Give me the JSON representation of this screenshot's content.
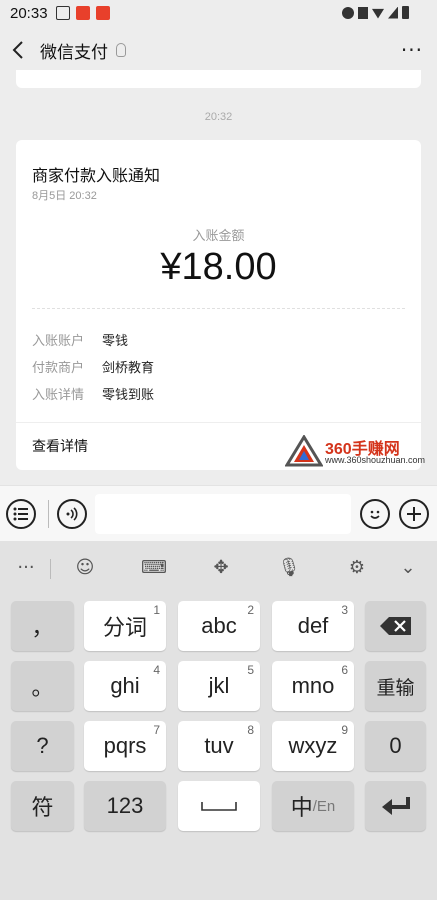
{
  "status_bar": {
    "time": "20:33"
  },
  "header": {
    "title": "微信支付",
    "more": "···"
  },
  "chat": {
    "timestamp": "20:32"
  },
  "card": {
    "title": "商家付款入账通知",
    "date": "8月5日  20:32",
    "amount_label": "入账金额",
    "amount": "¥18.00",
    "rows": [
      {
        "key": "入账账户",
        "value": "零钱"
      },
      {
        "key": "付款商户",
        "value": "剑桥教育"
      },
      {
        "key": "入账详情",
        "value": "零钱到账"
      }
    ],
    "detail_link": "查看详情"
  },
  "watermark": {
    "text": "360手赚网",
    "url": "www.360shouzhuan.com"
  },
  "keyboard": {
    "keys": [
      {
        "label": "，",
        "num": ""
      },
      {
        "label": "分词",
        "num": "1"
      },
      {
        "label": "abc",
        "num": "2"
      },
      {
        "label": "def",
        "num": "3"
      },
      {
        "label": "。",
        "num": ""
      },
      {
        "label": "ghi",
        "num": "4"
      },
      {
        "label": "jkl",
        "num": "5"
      },
      {
        "label": "mno",
        "num": "6"
      },
      {
        "label": "重输",
        "num": ""
      },
      {
        "label": "?",
        "num": ""
      },
      {
        "label": "pqrs",
        "num": "7"
      },
      {
        "label": "tuv",
        "num": "8"
      },
      {
        "label": "wxyz",
        "num": "9"
      },
      {
        "label": "0",
        "num": ""
      },
      {
        "label": "符",
        "num": ""
      },
      {
        "label": "123",
        "num": ""
      },
      {
        "label": "中",
        "num": ""
      },
      {
        "label": "/En",
        "num": ""
      }
    ]
  },
  "colors": {
    "background": "#ededed",
    "card": "#ffffff",
    "watermark_red": "#d4341b"
  }
}
